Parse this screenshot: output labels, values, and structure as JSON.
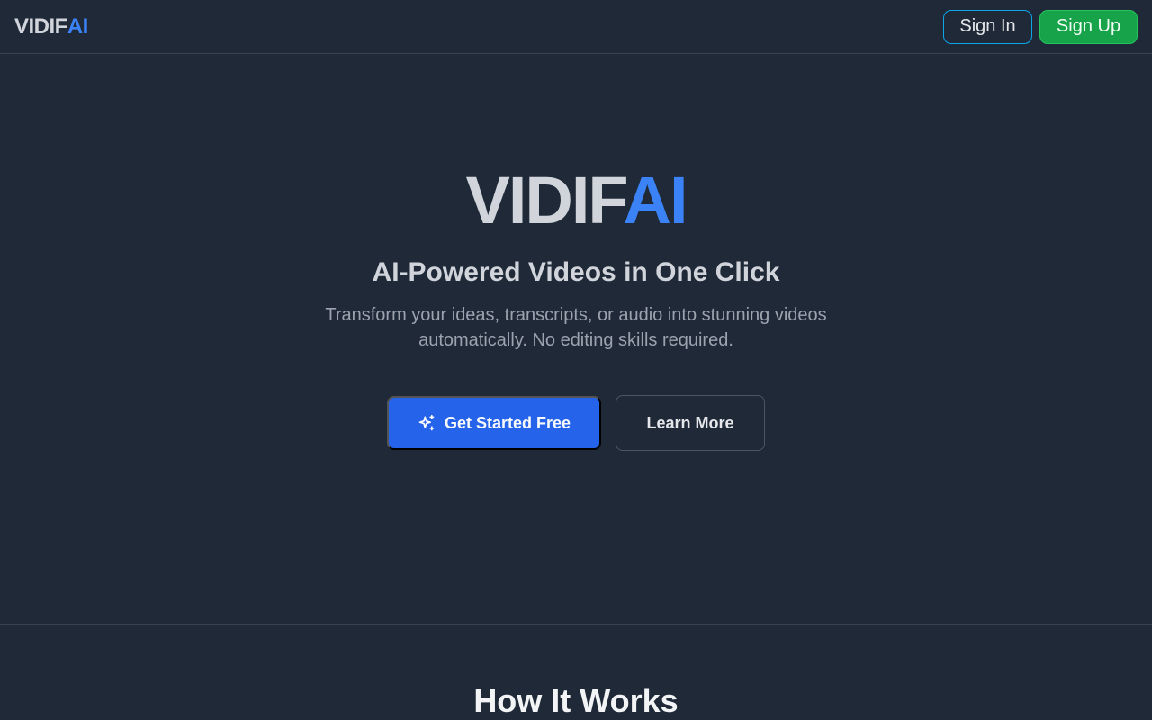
{
  "header": {
    "brand_part1": "VIDIF",
    "brand_part2": "AI",
    "sign_in_label": "Sign In",
    "sign_up_label": "Sign Up"
  },
  "hero": {
    "logo_part1": "VIDIF",
    "logo_part2": "AI",
    "tagline": "AI-Powered Videos in One Click",
    "description": "Transform your ideas, transcripts, or audio into stunning videos automatically. No editing skills required.",
    "primary_cta_label": "Get Started Free",
    "primary_cta_icon": "sparkles-icon",
    "secondary_cta_label": "Learn More"
  },
  "section": {
    "how_it_works_title": "How It Works"
  },
  "colors": {
    "background": "#1f2937",
    "accent_blue": "#3b82f6",
    "primary_button": "#2563eb",
    "sign_up_green": "#16a34a",
    "sign_in_border": "#0ea5e9"
  }
}
